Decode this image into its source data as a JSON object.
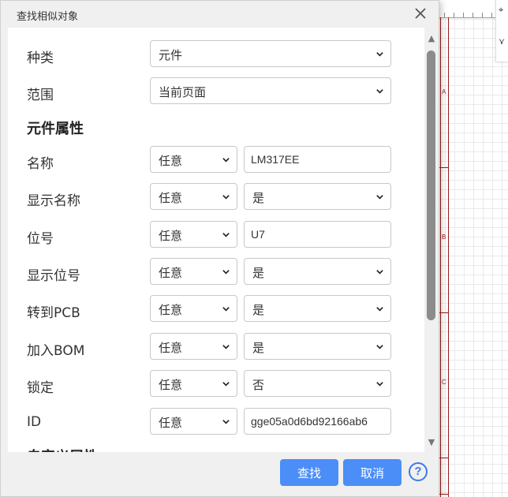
{
  "dialog": {
    "title": "查找相似对象",
    "close_icon": "close-icon"
  },
  "form": {
    "type_label": "种类",
    "type_value": "元件",
    "scope_label": "范围",
    "scope_value": "当前页面",
    "section_component": "元件属性",
    "section_custom": "自定义属性",
    "any": "任意",
    "rows": [
      {
        "label": "名称",
        "match": "任意",
        "value": "LM317EE",
        "kind": "input"
      },
      {
        "label": "显示名称",
        "match": "任意",
        "value": "是",
        "kind": "select"
      },
      {
        "label": "位号",
        "match": "任意",
        "value": "U7",
        "kind": "input"
      },
      {
        "label": "显示位号",
        "match": "任意",
        "value": "是",
        "kind": "select"
      },
      {
        "label": "转到PCB",
        "match": "任意",
        "value": "是",
        "kind": "select"
      },
      {
        "label": "加入BOM",
        "match": "任意",
        "value": "是",
        "kind": "select"
      },
      {
        "label": "锁定",
        "match": "任意",
        "value": "否",
        "kind": "select"
      },
      {
        "label": "ID",
        "match": "任意",
        "value": "gge05a0d6bd92166ab6",
        "kind": "input"
      }
    ]
  },
  "footer": {
    "find_label": "查找",
    "cancel_label": "取消",
    "help_glyph": "?"
  },
  "canvas": {
    "zone_a": "A",
    "zone_b": "B",
    "zone_c": "C"
  },
  "colors": {
    "accent": "#4c8ef7",
    "sheet_border": "#9b1b1b",
    "help": "#3b7be6"
  }
}
